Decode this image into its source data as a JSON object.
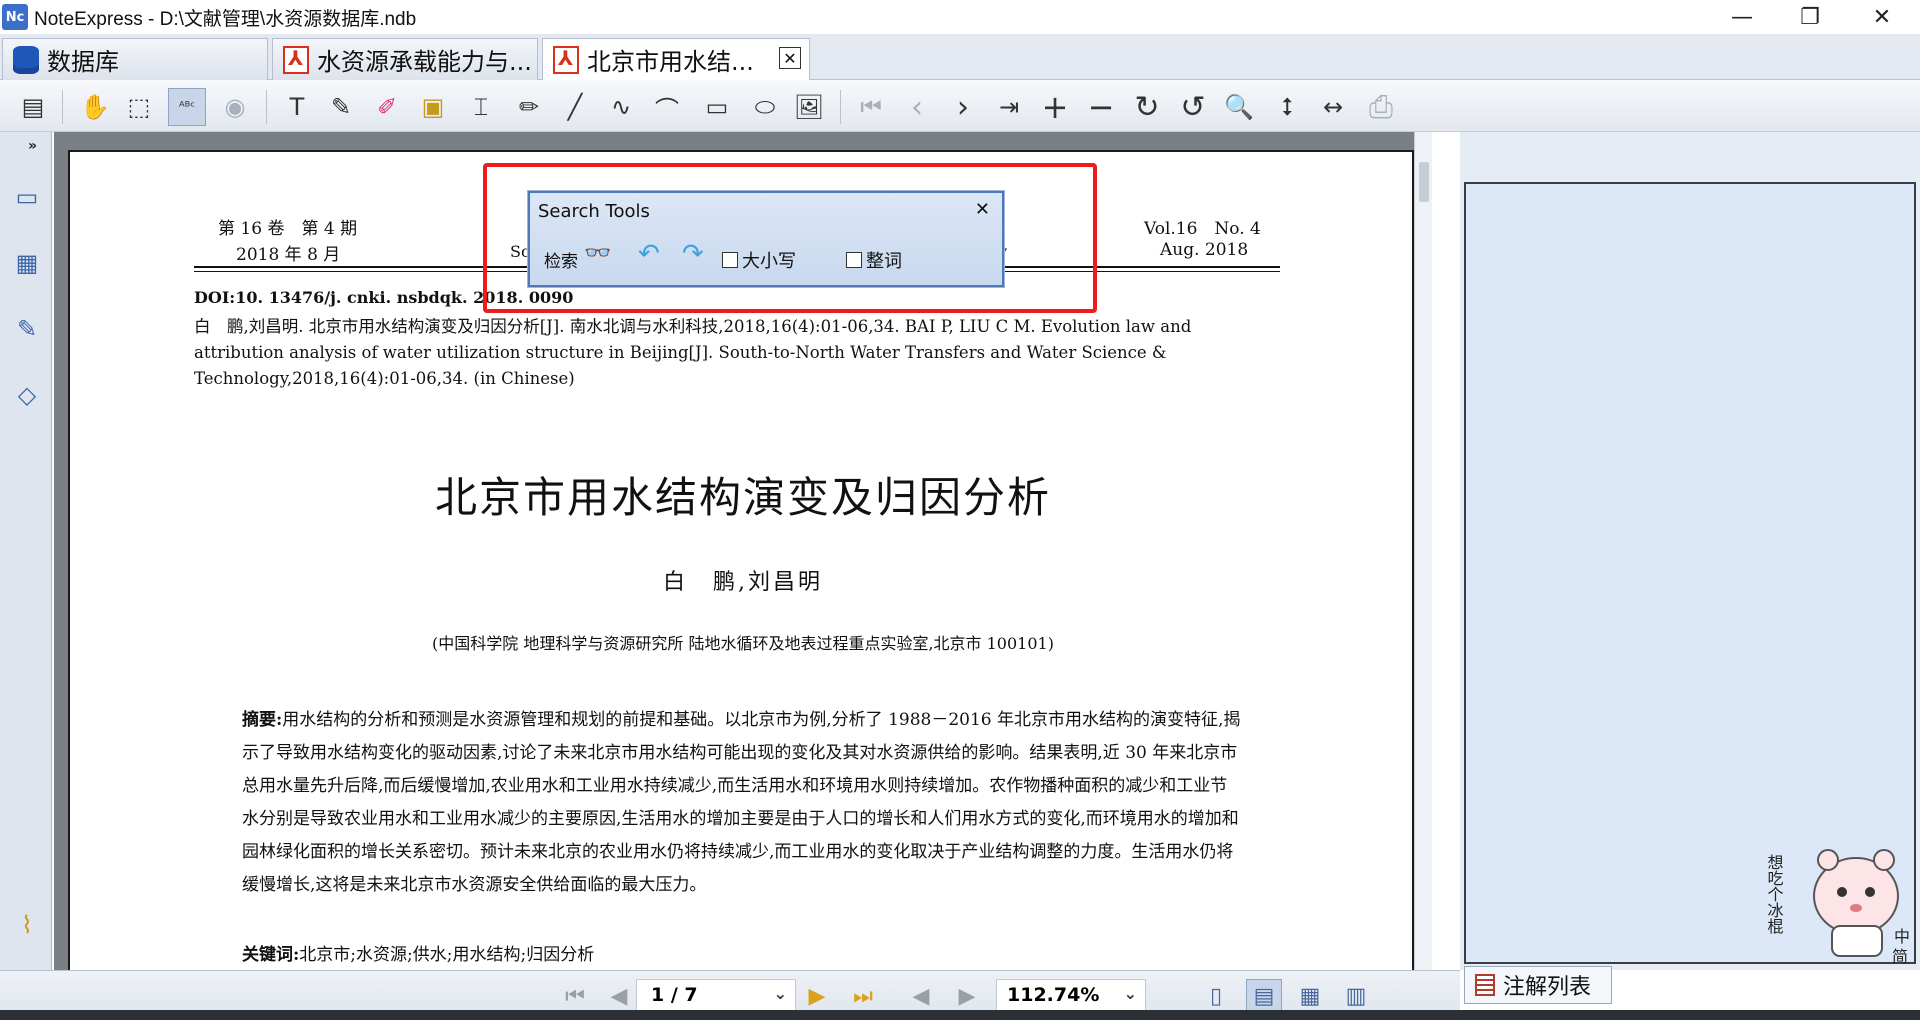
{
  "window": {
    "app_icon": "Nc",
    "title": "NoteExpress - D:\\文献管理\\水资源数据库.ndb",
    "minimize": "—",
    "maximize": "❐",
    "close": "✕"
  },
  "tabs": [
    {
      "label": "数据库",
      "icon": "database-icon",
      "active": false
    },
    {
      "label": "水资源承载能力与...",
      "icon": "pdf-icon",
      "active": false
    },
    {
      "label": "北京市用水结...",
      "icon": "pdf-icon",
      "active": true,
      "close": "✕"
    }
  ],
  "toolbar": {
    "glyphs": {
      "note": "▤",
      "hand": "✋",
      "select_rect": "⬚",
      "text_select": "ᴬᴮᶜ",
      "camera": "◉",
      "text_note": "T",
      "edit_note": "✎",
      "highlight": "✐",
      "area_highlight": "▣",
      "textbox": "⌶",
      "pencil": "✏",
      "line": "╱",
      "freehand": "∿",
      "curve": "⌒",
      "rectangle": "▭",
      "ellipse": "⬭",
      "image": "🖼",
      "first": "⏮",
      "prev": "‹",
      "next": "›",
      "last": "⇥",
      "zoom_in": "+",
      "zoom_out": "−",
      "rotate_cw": "↻",
      "rotate_ccw": "↺",
      "zoom": "🔍",
      "fit_height": "⭥",
      "fit_width": "↔",
      "print": "⎙"
    }
  },
  "sidebar": {
    "expand": "»",
    "glyphs": {
      "bookmarks": "▭",
      "thumbnails": "▦",
      "notes": "✎",
      "layers": "◇",
      "attachments": "⌇"
    }
  },
  "document": {
    "header_left_1": "第 16 卷　第 4 期",
    "header_left_2": "2018 年 8 月",
    "header_mid_left": "Sou",
    "header_mid_right": "y",
    "header_right_1": "Vol.16　No. 4",
    "header_right_2": "Aug. 2018",
    "doi": "DOI:10. 13476/j. cnki. nsbdqk. 2018. 0090",
    "citation": "白　鹏,刘昌明. 北京市用水结构演变及归因分析[J]. 南水北调与水利科技,2018,16(4):01-06,34. BAI P, LIU C M. Evolution law and attribution analysis of water utilization structure in Beijing[J]. South-to-North Water Transfers and Water Science & Technology,2018,16(4):01-06,34. (in Chinese)",
    "title": "北京市用水结构演变及归因分析",
    "authors": "白　鹏,刘昌明",
    "affiliation": "(中国科学院 地理科学与资源研究所 陆地水循环及地表过程重点实验室,北京市 100101)",
    "abstract_label": "摘要:",
    "abstract": "用水结构的分析和预测是水资源管理和规划的前提和基础。以北京市为例,分析了 1988－2016 年北京市用水结构的演变特征,揭示了导致用水结构变化的驱动因素,讨论了未来北京市用水结构可能出现的变化及其对水资源供给的影响。结果表明,近 30 年来北京市总用水量先升后降,而后缓慢增加,农业用水和工业用水持续减少,而生活用水和环境用水则持续增加。农作物播种面积的减少和工业节水分别是导致农业用水和工业用水减少的主要原因,生活用水的增加主要是由于人口的增长和人们用水方式的变化,而环境用水的增加和园林绿化面积的增长关系密切。预计未来北京的农业用水仍将持续减少,而工业用水的变化取决于产业结构调整的力度。生活用水仍将缓慢增长,这将是未来北京市水资源安全供给面临的最大压力。",
    "keywords_label": "关键词:",
    "keywords": "北京市;水资源;供水;用水结构;归因分析"
  },
  "search_tools": {
    "title": "Search Tools",
    "close": "✕",
    "search_label": "检索",
    "binoculars": "👓",
    "undo": "↶",
    "redo": "↷",
    "match_case_label": "大小写",
    "whole_word_label": "整词"
  },
  "right_panel": {
    "tab_label": "注解列表",
    "mascot_text": "想吃个冰棍",
    "mascot_mark_1": "中",
    "mascot_mark_2": "简"
  },
  "statusbar": {
    "first": "⏮",
    "prev": "◀",
    "next": "▶",
    "last": "⏭",
    "back": "◀",
    "forward": "▶",
    "page_indicator": "1 / 7",
    "zoom": "112.74%",
    "dropdown": "⌄",
    "view_glyphs": {
      "single": "▯",
      "continuous": "▤",
      "facing": "▦",
      "book": "▥"
    }
  },
  "colors": {
    "highlight_box": "#ee1c1c",
    "dialog_border": "#4f78b8",
    "accent": "#1f57b8"
  }
}
